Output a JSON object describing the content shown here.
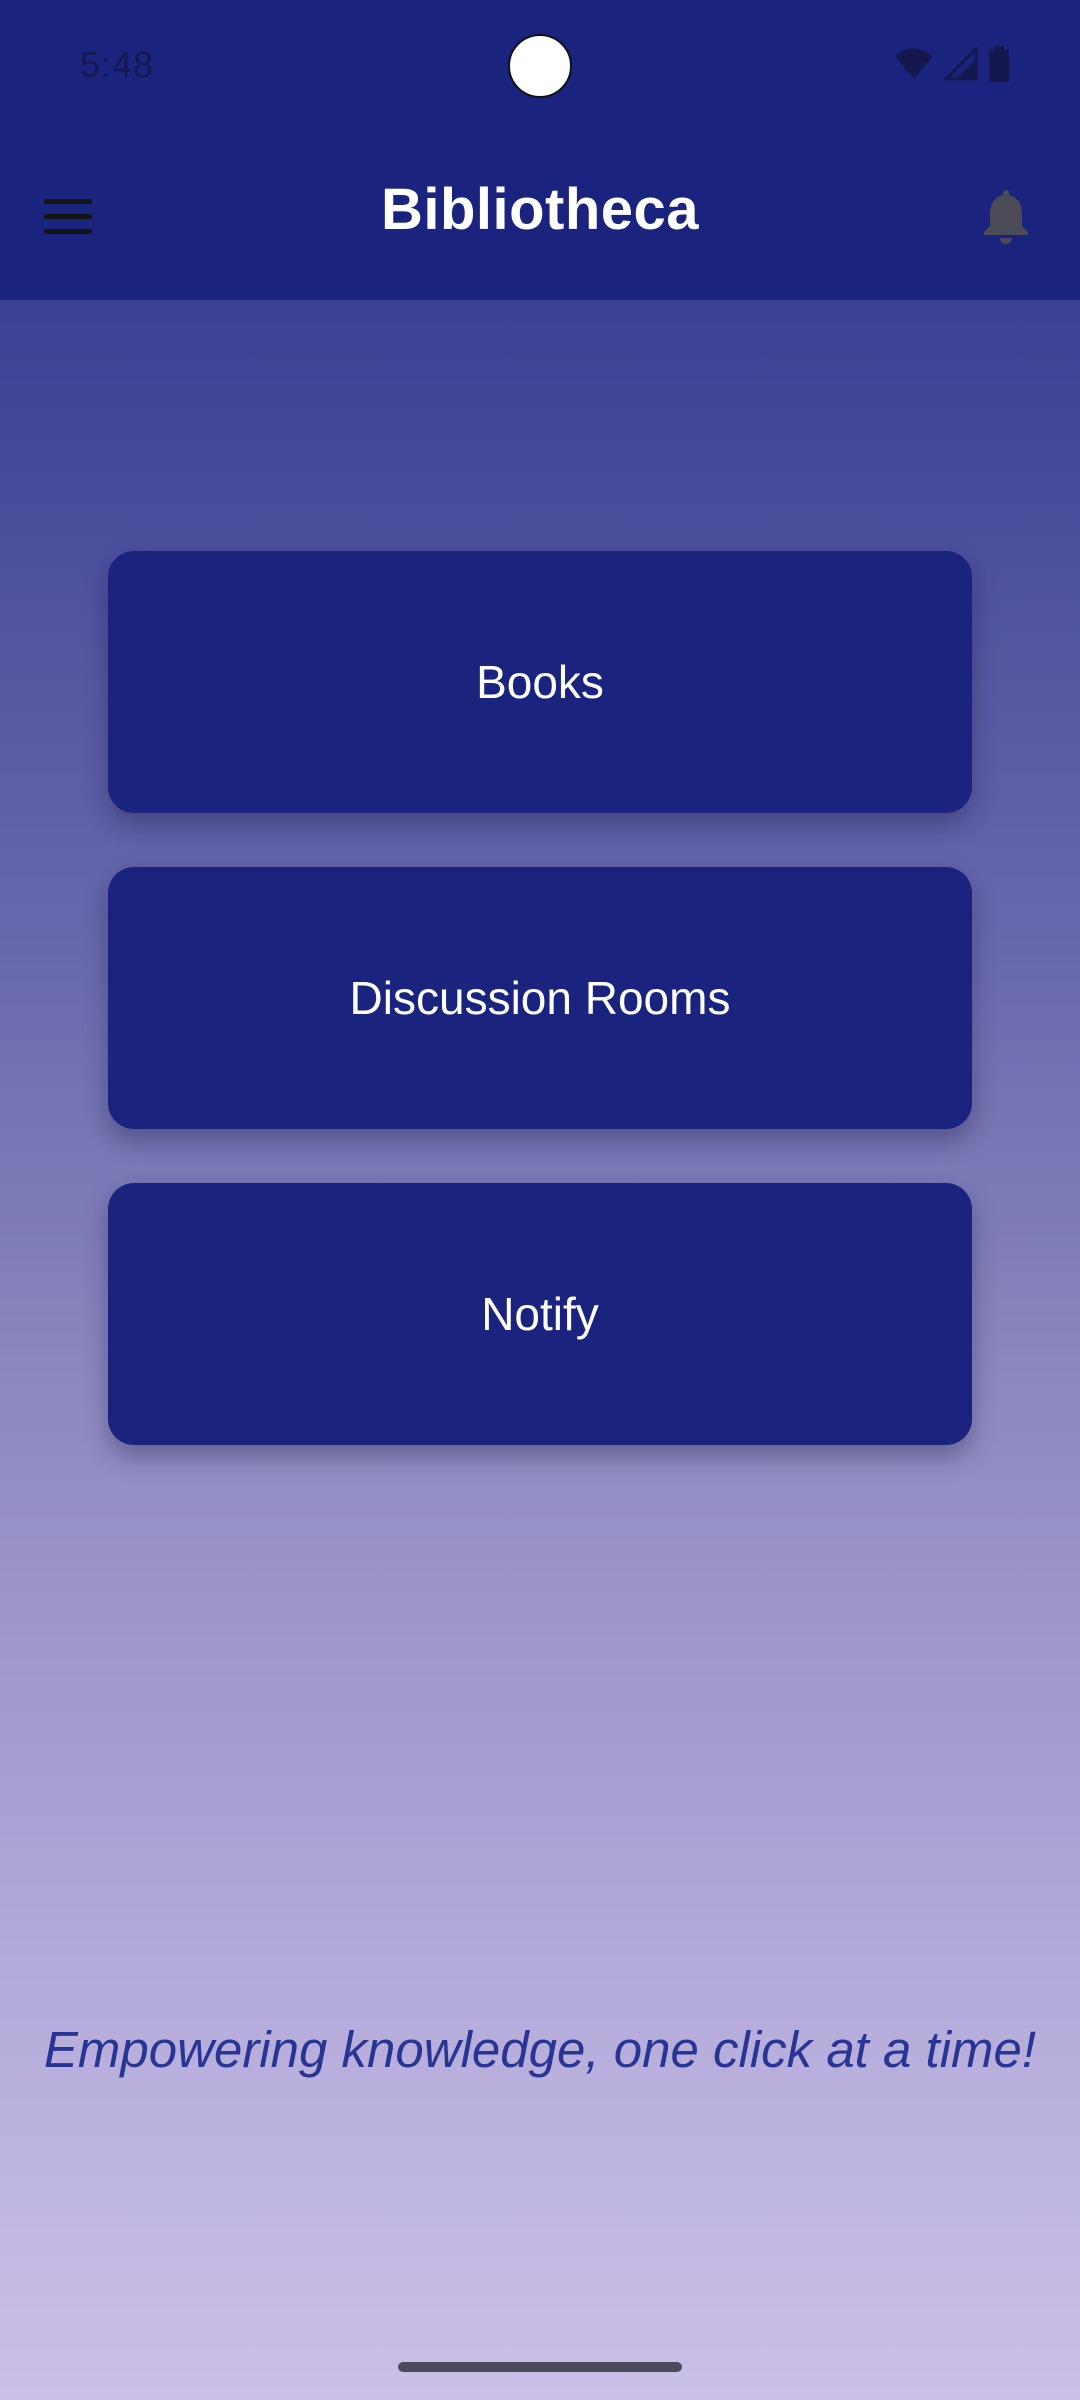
{
  "status_bar": {
    "time": "5:48",
    "icons": [
      "wifi-icon",
      "signal-icon",
      "battery-icon"
    ]
  },
  "app_bar": {
    "title": "Bibliotheca",
    "menu_icon": "hamburger-menu-icon",
    "notification_icon": "bell-icon"
  },
  "main": {
    "buttons": [
      {
        "label": "Books"
      },
      {
        "label": "Discussion Rooms"
      },
      {
        "label": "Notify"
      }
    ],
    "tagline": "Empowering knowledge, one click at a time!"
  },
  "colors": {
    "primary": "#1a237e",
    "tagline": "#283593",
    "gradient_top": "#3b3f92",
    "gradient_bottom": "#cbc0e8"
  }
}
